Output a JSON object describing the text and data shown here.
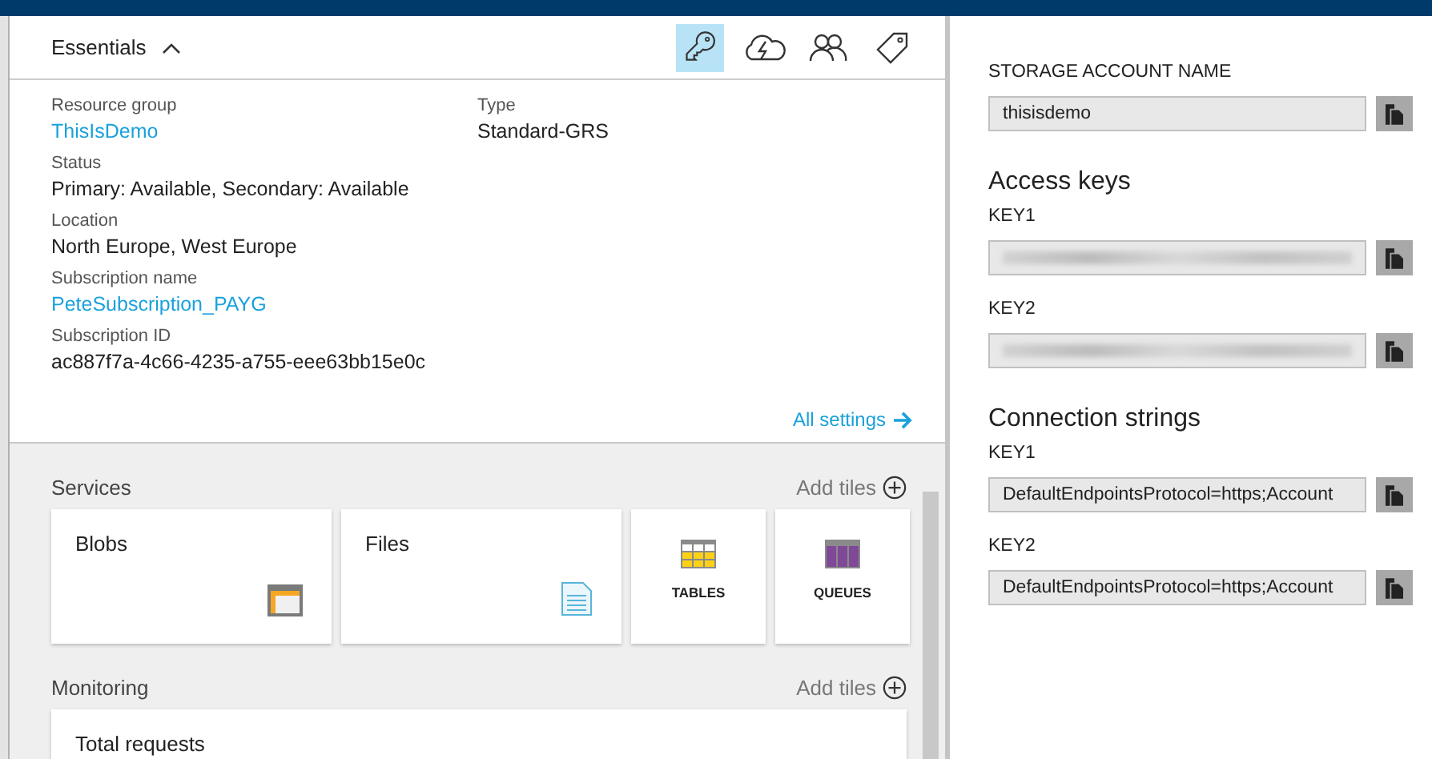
{
  "essentials": {
    "title": "Essentials",
    "expanded": true,
    "tools": [
      {
        "selected": true
      },
      {
        "selected": false
      },
      {
        "selected": false
      },
      {
        "selected": false
      }
    ],
    "columns": [
      [
        {
          "label": "Resource group",
          "value": "ThisIsDemo",
          "link": true
        },
        {
          "label": "Status",
          "value": "Primary: Available, Secondary: Available",
          "link": false
        },
        {
          "label": "Location",
          "value": "North Europe, West Europe",
          "link": false
        },
        {
          "label": "Subscription name",
          "value": "PeteSubscription_PAYG",
          "link": true
        },
        {
          "label": "Subscription ID",
          "value": "ac887f7a-4c66-4235-a755-eee63bb15e0c",
          "link": false
        }
      ],
      [
        {
          "label": "Type",
          "value": "Standard-GRS",
          "link": false
        }
      ]
    ],
    "all_settings": "All settings"
  },
  "sections": [
    {
      "title": "Services",
      "add_label": "Add tiles",
      "tiles": [
        {
          "kind": "blobs",
          "title": "Blobs"
        },
        {
          "kind": "files",
          "title": "Files"
        },
        {
          "kind": "tables",
          "title": "TABLES"
        },
        {
          "kind": "queues",
          "title": "QUEUES"
        }
      ]
    },
    {
      "title": "Monitoring",
      "add_label": "Add tiles",
      "tiles": [
        {
          "kind": "metric",
          "title": "Total requests"
        }
      ]
    }
  ],
  "keys_pane": {
    "groups": [
      {
        "fields": [
          {
            "label": "STORAGE ACCOUNT NAME",
            "value": "thisisdemo",
            "masked": false
          }
        ]
      },
      {
        "heading": "Access keys",
        "fields": [
          {
            "label": "KEY1",
            "masked": true
          },
          {
            "label": "KEY2",
            "masked": true
          }
        ]
      },
      {
        "heading": "Connection strings",
        "fields": [
          {
            "label": "KEY1",
            "value": "DefaultEndpointsProtocol=https;Account",
            "masked": false
          },
          {
            "label": "KEY2",
            "value": "DefaultEndpointsProtocol=https;Account",
            "masked": false
          }
        ]
      }
    ]
  }
}
